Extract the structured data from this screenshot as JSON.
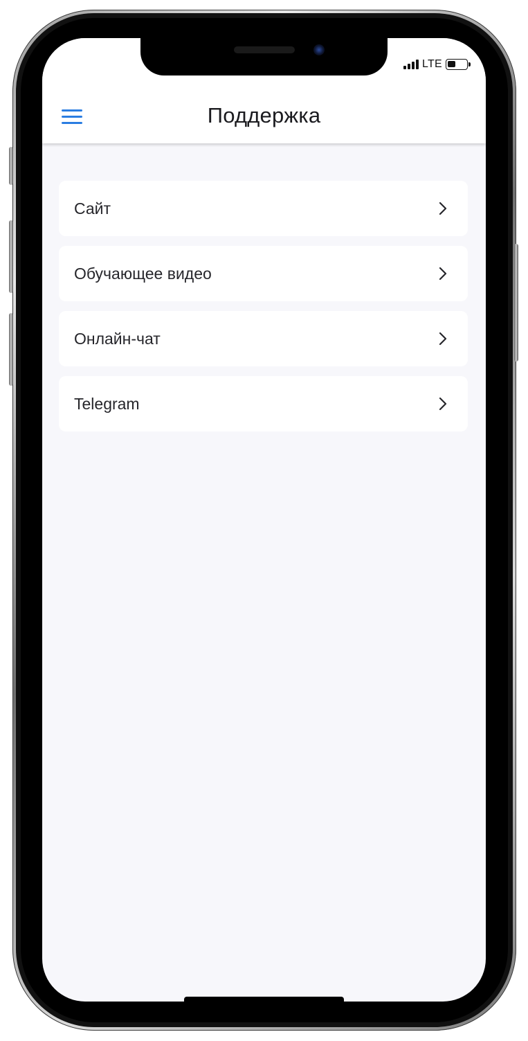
{
  "status_bar": {
    "network": "LTE"
  },
  "header": {
    "title": "Поддержка",
    "menu_icon": "hamburger-menu-icon"
  },
  "support_items": [
    {
      "label": "Сайт",
      "icon": "chevron-right-icon"
    },
    {
      "label": "Обучающее видео",
      "icon": "chevron-right-icon"
    },
    {
      "label": "Онлайн-чат",
      "icon": "chevron-right-icon"
    },
    {
      "label": "Telegram",
      "icon": "chevron-right-icon"
    }
  ],
  "colors": {
    "accent": "#2a7de1",
    "background": "#f7f7fb",
    "card": "#ffffff",
    "text": "#26262b"
  }
}
